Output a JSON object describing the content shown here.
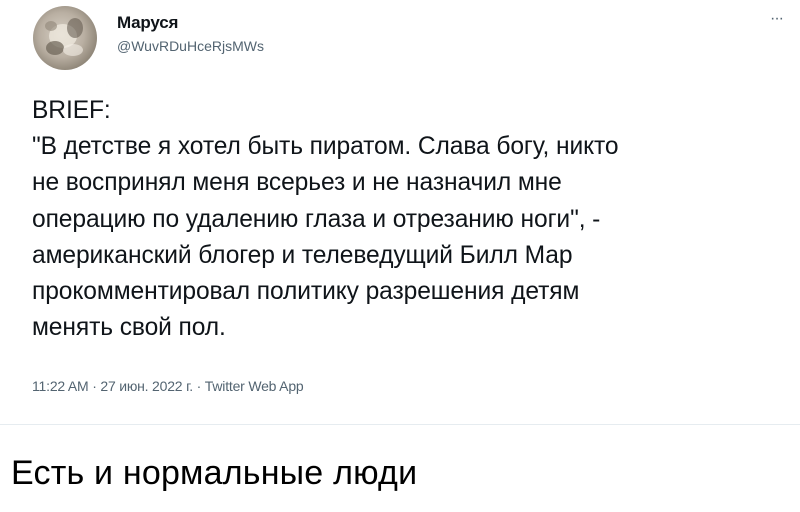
{
  "tweet": {
    "author": {
      "display_name": "Маруся",
      "handle": "@WuvRDuHceRjsMWs",
      "avatar_icon": "avatar-photo"
    },
    "more_icon": "more-horizontal-icon",
    "more_glyph": "···",
    "text": "BRIEF:\n \"В детстве я хотел быть пиратом. Слава богу, никто\nне воспринял меня всерьез и не назначил мне\nоперацию по удалению глаза и отрезанию ноги\", -\nамериканский блогер и телеведущий Билл Мар\nпрокомментировал политику разрешения детям\nменять свой пол.",
    "meta": "11:22 AM · 27 июн. 2022 г. · Twitter Web App"
  },
  "caption": "Есть и нормальные люди",
  "colors": {
    "text": "#0f1419",
    "secondary": "#536471",
    "background": "#ffffff"
  }
}
